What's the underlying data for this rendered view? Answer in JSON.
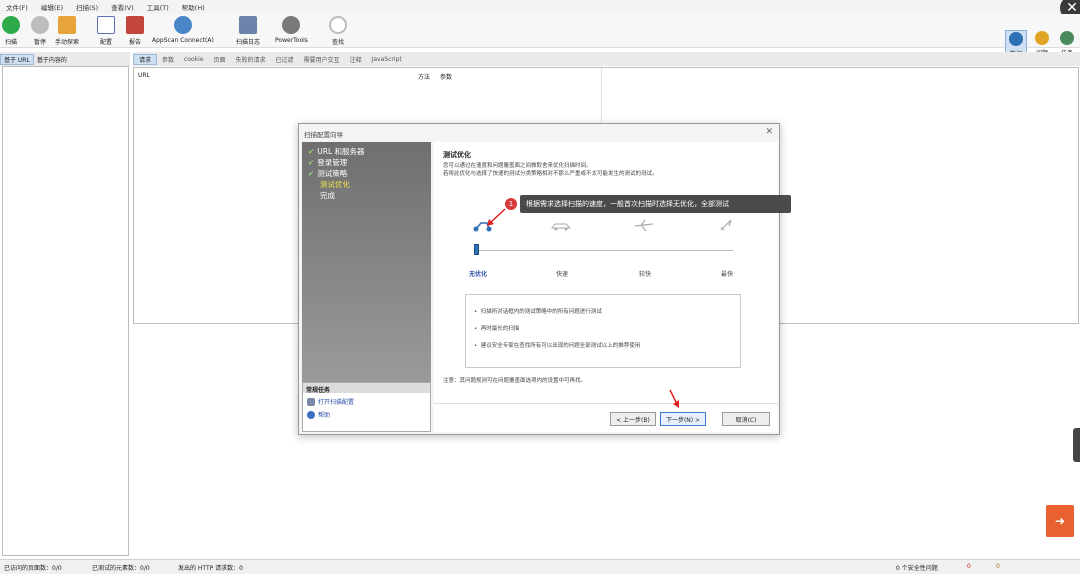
{
  "menu": [
    "文件(F)",
    "编辑(E)",
    "扫描(S)",
    "查看(V)",
    "工具(T)",
    "帮助(H)"
  ],
  "toolbar": {
    "items": [
      {
        "label": "扫描",
        "color": "#2eaa4a"
      },
      {
        "label": "暂停",
        "color": "#b7b7b7"
      },
      {
        "label": "手动探索",
        "color": "#e6a43a"
      },
      {
        "label": "配置",
        "color": "#5a6fb8"
      },
      {
        "label": "报告",
        "color": "#c2473a"
      },
      {
        "label": "AppScan Connect(A)",
        "color": "#4a86c9"
      },
      {
        "label": "扫描日志",
        "color": "#6c84a9"
      },
      {
        "label": "PowerTools",
        "color": "#7a7a7a"
      },
      {
        "label": "查找",
        "color": "#c7c7c7"
      }
    ],
    "right": [
      "数据",
      "问题",
      "任务"
    ]
  },
  "left_tabs": [
    "基于 URL",
    "基于内容的"
  ],
  "right_tabs": [
    "请求",
    "参数",
    "cookie",
    "页面",
    "失败的请求",
    "已过滤",
    "需要用户交互",
    "注释",
    "JavaScript"
  ],
  "grid_headers": [
    "URL",
    "方法",
    "参数"
  ],
  "status": {
    "visited": "已访问的页面数：0/0",
    "tested": "已测试的元素数：0/0",
    "http": "发出的 HTTP 请求数：0",
    "security": "0 个安全性问题",
    "errors": "0",
    "warnings": "0"
  },
  "dialog": {
    "title": "扫描配置向导",
    "steps": [
      {
        "label": "URL 和服务器",
        "done": true
      },
      {
        "label": "登录管理",
        "done": true
      },
      {
        "label": "测试策略",
        "done": true
      },
      {
        "label": "测试优化",
        "done": false,
        "current": true
      },
      {
        "label": "完成",
        "done": false
      }
    ],
    "tasks_title": "常规任务",
    "tasks": [
      "打开扫描配置",
      "帮助"
    ],
    "heading": "测试优化",
    "desc": "您可以通过在速度和问题覆盖面之间做取舍来优化扫描时间。\n若将此优化与选择了快速的测试分类策略相对不那么严重或不太可能发生的测试的测试。",
    "speeds": [
      "无优化",
      "快速",
      "较快",
      "最快"
    ],
    "selected_speed": 0,
    "info": [
      "扫描所对话框内的测试策略中的所有问题进行测试",
      "再时最长的扫描",
      "建议安全专家在查找所有可以出现的问题全部测试以上的推荐使用"
    ],
    "note": "注意：其问题规则可在问题覆盖面选项内的设置中可再找。",
    "buttons": {
      "back": "< 上一步(B)",
      "next": "下一步(N) >",
      "cancel": "取消(C)"
    }
  },
  "tooltip": {
    "number": "1",
    "text": "根据需求选择扫描的速度，一般首次扫描时选择无优化，全部测试"
  }
}
